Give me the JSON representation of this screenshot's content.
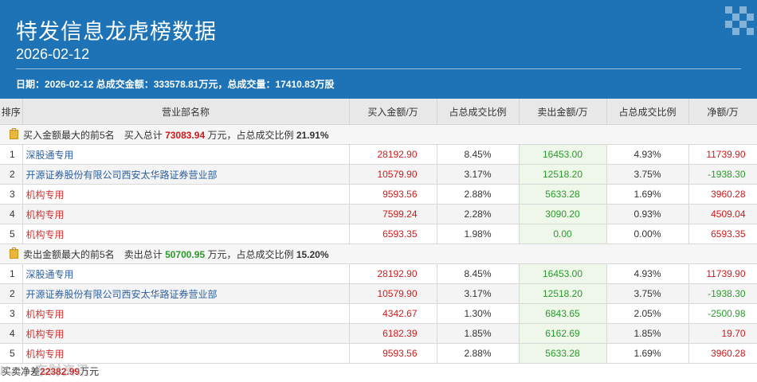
{
  "header": {
    "title": "特发信息龙虎榜数据",
    "date": "2026-02-12",
    "summary": "日期：2026-02-12 总成交金额：333578.81万元，总成交量：17410.83万股"
  },
  "columns": [
    "排序",
    "营业部名称",
    "买入金额/万",
    "占总成交比例",
    "卖出金额/万",
    "占总成交比例",
    "净额/万"
  ],
  "buy_group": {
    "label": "买入金额最大的前5名",
    "total_prefix": "买入总计",
    "total_value": "73083.94",
    "total_suffix": "万元，占总成交比例",
    "ratio": "21.91%"
  },
  "buy_rows": [
    {
      "rank": "1",
      "name": "深股通专用",
      "buy": "28192.90",
      "buy_pct": "8.45%",
      "sell": "16453.00",
      "sell_pct": "4.93%",
      "net": "11739.90",
      "inst": false,
      "net_sign": "pos"
    },
    {
      "rank": "2",
      "name": "开源证券股份有限公司西安太华路证券营业部",
      "buy": "10579.90",
      "buy_pct": "3.17%",
      "sell": "12518.20",
      "sell_pct": "3.75%",
      "net": "-1938.30",
      "inst": false,
      "net_sign": "neg"
    },
    {
      "rank": "3",
      "name": "机构专用",
      "buy": "9593.56",
      "buy_pct": "2.88%",
      "sell": "5633.28",
      "sell_pct": "1.69%",
      "net": "3960.28",
      "inst": true,
      "net_sign": "pos"
    },
    {
      "rank": "4",
      "name": "机构专用",
      "buy": "7599.24",
      "buy_pct": "2.28%",
      "sell": "3090.20",
      "sell_pct": "0.93%",
      "net": "4509.04",
      "inst": true,
      "net_sign": "pos"
    },
    {
      "rank": "5",
      "name": "机构专用",
      "buy": "6593.35",
      "buy_pct": "1.98%",
      "sell": "0.00",
      "sell_pct": "0.00%",
      "net": "6593.35",
      "inst": true,
      "net_sign": "pos"
    }
  ],
  "sell_group": {
    "label": "卖出金额最大的前5名",
    "total_prefix": "卖出总计",
    "total_value": "50700.95",
    "total_suffix": "万元，占总成交比例",
    "ratio": "15.20%"
  },
  "sell_rows": [
    {
      "rank": "1",
      "name": "深股通专用",
      "buy": "28192.90",
      "buy_pct": "8.45%",
      "sell": "16453.00",
      "sell_pct": "4.93%",
      "net": "11739.90",
      "inst": false,
      "net_sign": "pos"
    },
    {
      "rank": "2",
      "name": "开源证券股份有限公司西安太华路证券营业部",
      "buy": "10579.90",
      "buy_pct": "3.17%",
      "sell": "12518.20",
      "sell_pct": "3.75%",
      "net": "-1938.30",
      "inst": false,
      "net_sign": "neg"
    },
    {
      "rank": "3",
      "name": "机构专用",
      "buy": "4342.67",
      "buy_pct": "1.30%",
      "sell": "6843.65",
      "sell_pct": "2.05%",
      "net": "-2500.98",
      "inst": true,
      "net_sign": "neg"
    },
    {
      "rank": "4",
      "name": "机构专用",
      "buy": "6182.39",
      "buy_pct": "1.85%",
      "sell": "6162.69",
      "sell_pct": "1.85%",
      "net": "19.70",
      "inst": true,
      "net_sign": "pos"
    },
    {
      "rank": "5",
      "name": "机构专用",
      "buy": "9593.56",
      "buy_pct": "2.88%",
      "sell": "5633.28",
      "sell_pct": "1.69%",
      "net": "3960.28",
      "inst": true,
      "net_sign": "pos"
    }
  ],
  "footer": {
    "prefix": "买卖净差",
    "value": "22382.99",
    "suffix": "万元"
  },
  "watermark": "K.co 东财资讯",
  "colors": {
    "header_bg": "#1d73b6",
    "positive": "#d11919",
    "negative": "#2a9a2a"
  }
}
